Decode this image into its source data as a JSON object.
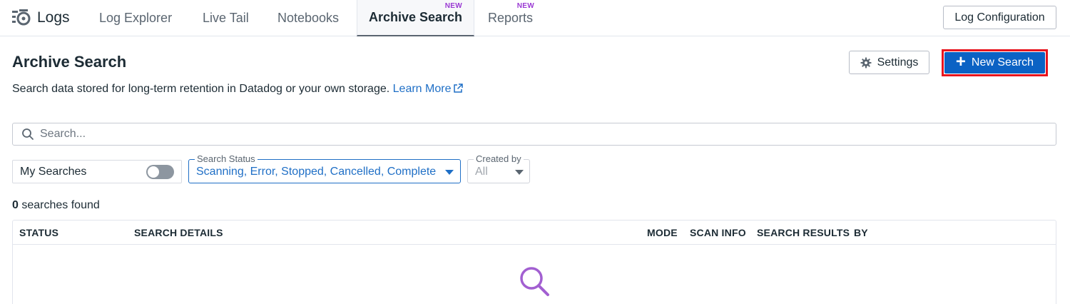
{
  "nav": {
    "brand_label": "Logs",
    "brand_icon": "logs-icon",
    "tabs": [
      {
        "label": "Log Explorer",
        "badge": ""
      },
      {
        "label": "Live Tail",
        "badge": ""
      },
      {
        "label": "Notebooks",
        "badge": ""
      },
      {
        "label": "Archive Search",
        "badge": "NEW",
        "active": true
      },
      {
        "label": "Reports",
        "badge": "NEW"
      }
    ],
    "config_button": "Log Configuration"
  },
  "header": {
    "title": "Archive Search",
    "subtitle": "Search data stored for long-term retention in Datadog or your own storage.",
    "learn_more": "Learn More",
    "settings_label": "Settings",
    "new_search_label": "New Search"
  },
  "search": {
    "placeholder": "Search..."
  },
  "filters": {
    "my_searches_label": "My Searches",
    "my_searches_on": false,
    "status_legend": "Search Status",
    "status_value": "Scanning, Error, Stopped, Cancelled, Complete",
    "created_by_legend": "Created by",
    "created_by_value": "All"
  },
  "results": {
    "count": "0",
    "count_suffix": "searches found",
    "columns": [
      "STATUS",
      "SEARCH DETAILS",
      "MODE",
      "SCAN INFO",
      "SEARCH RESULTS",
      "BY"
    ]
  },
  "colors": {
    "accent": "#0b62c4",
    "link": "#1f6fc6",
    "badge": "#9a3ad3",
    "highlight_frame": "#e8141e",
    "empty_icon": "#a25fd1"
  }
}
